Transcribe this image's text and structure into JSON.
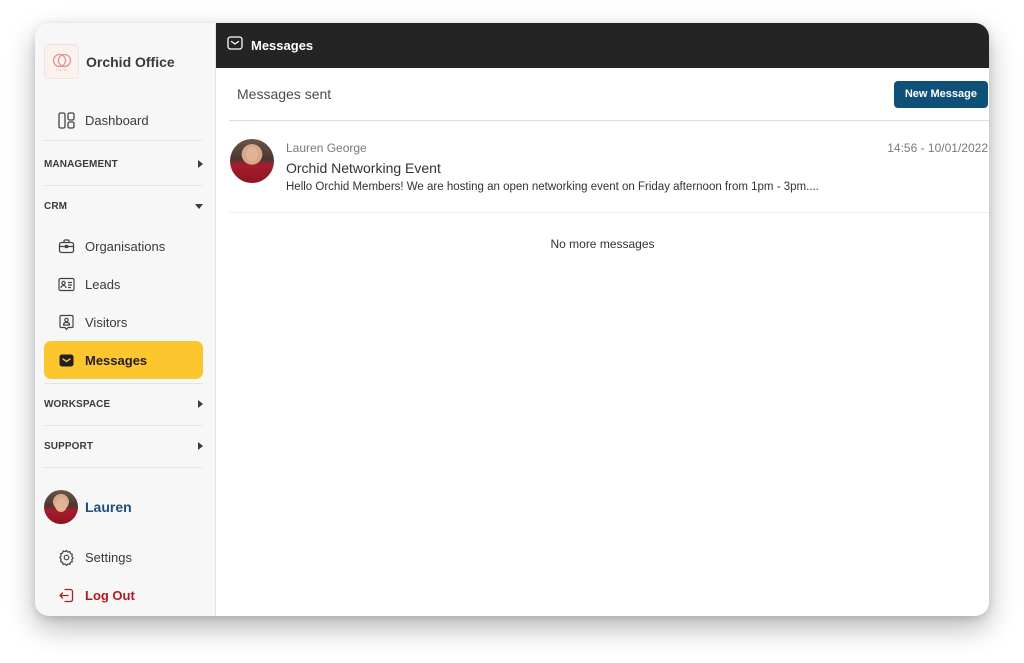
{
  "brand": {
    "name": "Orchid Office",
    "logo_icon": "orchid-rings-logo"
  },
  "sidebar": {
    "top_items": [
      {
        "label": "Dashboard",
        "icon": "dashboard-icon"
      }
    ],
    "sections": [
      {
        "label": "MANAGEMENT",
        "expanded": false
      },
      {
        "label": "CRM",
        "expanded": true
      },
      {
        "label": "WORKSPACE",
        "expanded": false
      },
      {
        "label": "SUPPORT",
        "expanded": false
      }
    ],
    "crm_items": [
      {
        "label": "Organisations",
        "icon": "briefcase-icon"
      },
      {
        "label": "Leads",
        "icon": "id-card-icon"
      },
      {
        "label": "Visitors",
        "icon": "visitor-badge-icon"
      },
      {
        "label": "Messages",
        "icon": "envelope-icon",
        "active": true
      }
    ],
    "user": {
      "name": "Lauren"
    },
    "bottom_items": [
      {
        "label": "Settings",
        "icon": "gear-icon"
      },
      {
        "label": "Log Out",
        "icon": "logout-icon"
      }
    ]
  },
  "topbar": {
    "title": "Messages",
    "icon": "envelope-icon"
  },
  "main": {
    "subtitle": "Messages sent",
    "new_message_label": "New Message",
    "messages": [
      {
        "sender": "Lauren George",
        "subject": "Orchid Networking Event",
        "preview": "Hello Orchid Members! We are hosting an open networking event on Friday afternoon from 1pm - 3pm....",
        "timestamp": "14:56 - 10/01/2022"
      }
    ],
    "end_label": "No more messages"
  },
  "colors": {
    "accent_active": "#fcc62f",
    "topbar_bg": "#242424",
    "primary_button": "#0f5079",
    "user_name": "#1f4e79",
    "logout": "#b3191e"
  }
}
